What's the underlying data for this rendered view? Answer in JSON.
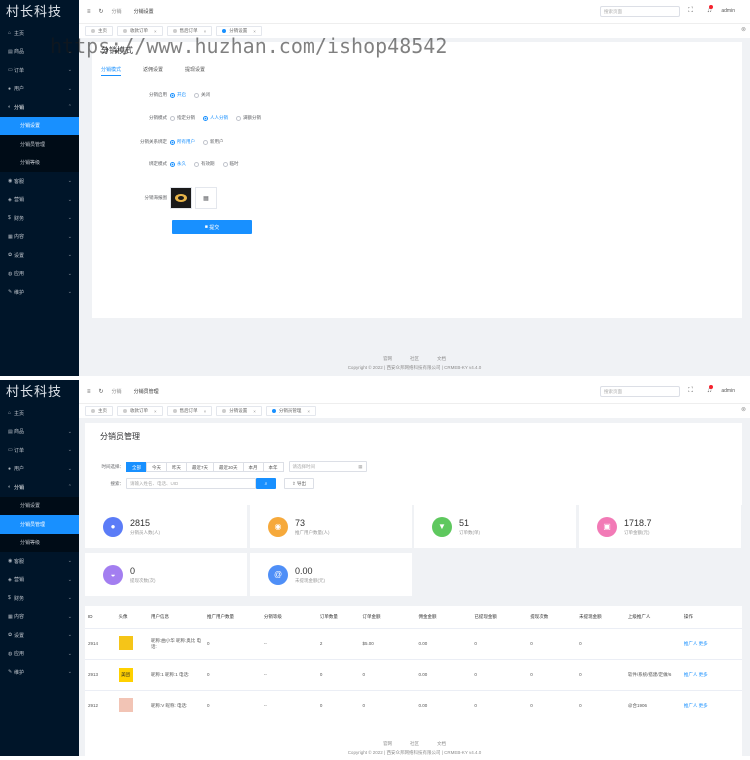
{
  "app": {
    "logo": "村长科技",
    "admin": "admin",
    "search_placeholder": "搜索页面"
  },
  "watermark": "https://www.huzhan.com/ishop48542",
  "menu": [
    {
      "label": "主页",
      "icon": "home-icon",
      "glyph": "⌂",
      "chev": false
    },
    {
      "label": "商品",
      "icon": "goods-icon",
      "glyph": "▤",
      "chev": true
    },
    {
      "label": "订单",
      "icon": "cart-icon",
      "glyph": "▭",
      "chev": true
    },
    {
      "label": "用户",
      "icon": "user-icon",
      "glyph": "●",
      "chev": true
    },
    {
      "label": "分销",
      "icon": "share-icon",
      "glyph": "◐",
      "chev": true
    },
    {
      "label": "客服",
      "icon": "service-icon",
      "glyph": "◉",
      "chev": true
    },
    {
      "label": "营销",
      "icon": "marketing-icon",
      "glyph": "◈",
      "chev": true
    },
    {
      "label": "财务",
      "icon": "finance-icon",
      "glyph": "$",
      "chev": true
    },
    {
      "label": "内容",
      "icon": "content-icon",
      "glyph": "▦",
      "chev": true
    },
    {
      "label": "设置",
      "icon": "settings-icon",
      "glyph": "✿",
      "chev": true
    },
    {
      "label": "应用",
      "icon": "apps-icon",
      "glyph": "◍",
      "chev": true
    },
    {
      "label": "维护",
      "icon": "maintain-icon",
      "glyph": "✎",
      "chev": true
    }
  ],
  "submenu": [
    "分销设置",
    "分销员管理",
    "分销等级"
  ],
  "panel1": {
    "crumb1": "分销",
    "crumb2": "分销设置",
    "tabs": [
      "主页",
      "收款订单",
      "售后订单",
      "分销设置"
    ],
    "page_title": "分销模式",
    "subtabs": [
      "分销模式",
      "返佣设置",
      "提现设置"
    ],
    "rows": [
      {
        "label": "分销启用",
        "options": [
          "开启",
          "关闭"
        ],
        "selected": 0
      },
      {
        "label": "分销模式",
        "options": [
          "指定分销",
          "人人分销",
          "满额分销"
        ],
        "selected": 1
      },
      {
        "label": "分销关系绑定",
        "options": [
          "所有用户",
          "新用户"
        ],
        "selected": 0
      },
      {
        "label": "绑定模式",
        "options": [
          "永久",
          "有效期",
          "临时"
        ],
        "selected": 0
      }
    ],
    "poster_label": "分销海报图",
    "submit": "提交"
  },
  "panel2": {
    "crumb1": "分销",
    "crumb2": "分销员管理",
    "tabs": [
      "主页",
      "收款订单",
      "售后订单",
      "分销设置",
      "分销员管理"
    ],
    "page_title": "分销员管理",
    "time_label": "时间选择：",
    "time_options": [
      "全部",
      "今天",
      "昨天",
      "最近7天",
      "最近30天",
      "本月",
      "本年"
    ],
    "date_placeholder": "请选择时间",
    "search_label": "搜索：",
    "search_placeholder": "请输入姓名、电话、UID",
    "export": "导出",
    "stats": [
      {
        "value": "2815",
        "label": "分销员人数(人)",
        "color": "#5b7cf7",
        "glyph": "●"
      },
      {
        "value": "73",
        "label": "推广用户数量(人)",
        "color": "#f6a93b",
        "glyph": "◉"
      },
      {
        "value": "51",
        "label": "订单数(单)",
        "color": "#5ec85e",
        "glyph": "▼"
      },
      {
        "value": "1718.7",
        "label": "订单金额(元)",
        "color": "#f27ab6",
        "glyph": "▣"
      },
      {
        "value": "0",
        "label": "提现次数(次)",
        "color": "#a37ef0",
        "glyph": "◒"
      },
      {
        "value": "0.00",
        "label": "未提现金额(元)",
        "color": "#4f8ff7",
        "glyph": "@"
      }
    ],
    "columns": [
      "ID",
      "头像",
      "用户信息",
      "推广用户数量",
      "分销等级",
      "订单数量",
      "订单金额",
      "佣金金额",
      "已提现金额",
      "提现次数",
      "未提现金额",
      "上级推广人",
      "操作"
    ],
    "rows": [
      {
        "id": "2914",
        "avatar": "#f5c518",
        "avatar_text": "",
        "info": "昵称:曲小华 昵称:奥比 电话:",
        "promo": "0",
        "level": "--",
        "orders": "2",
        "amount": "$5.00",
        "comm": "0.00",
        "withdrawn": "0",
        "times": "0",
        "unwithdrawn": "0",
        "parent": ""
      },
      {
        "id": "2913",
        "avatar": "#ffd100",
        "avatar_text": "美团",
        "info": "昵称:1 昵称:1 电话:",
        "promo": "0",
        "level": "--",
        "orders": "0",
        "amount": "0",
        "comm": "0.00",
        "withdrawn": "0",
        "times": "0",
        "unwithdrawn": "0",
        "parent": "软件/系统/搭建/定做/6"
      },
      {
        "id": "2912",
        "avatar": "#f2c4b5",
        "avatar_text": "",
        "info": "昵称:V 昵称: 电话:",
        "promo": "0",
        "level": "--",
        "orders": "0",
        "amount": "0",
        "comm": "0.00",
        "withdrawn": "0",
        "times": "0",
        "unwithdrawn": "0",
        "parent": "@合1906"
      }
    ],
    "action_promo": "推广人",
    "action_more": "更多"
  },
  "footer": {
    "links": [
      "官网",
      "社区",
      "文档"
    ],
    "copyright": "Copyright © 2022 | 西安众邦网络科技有限公司 | CRMEB-KY v4.4.0"
  }
}
